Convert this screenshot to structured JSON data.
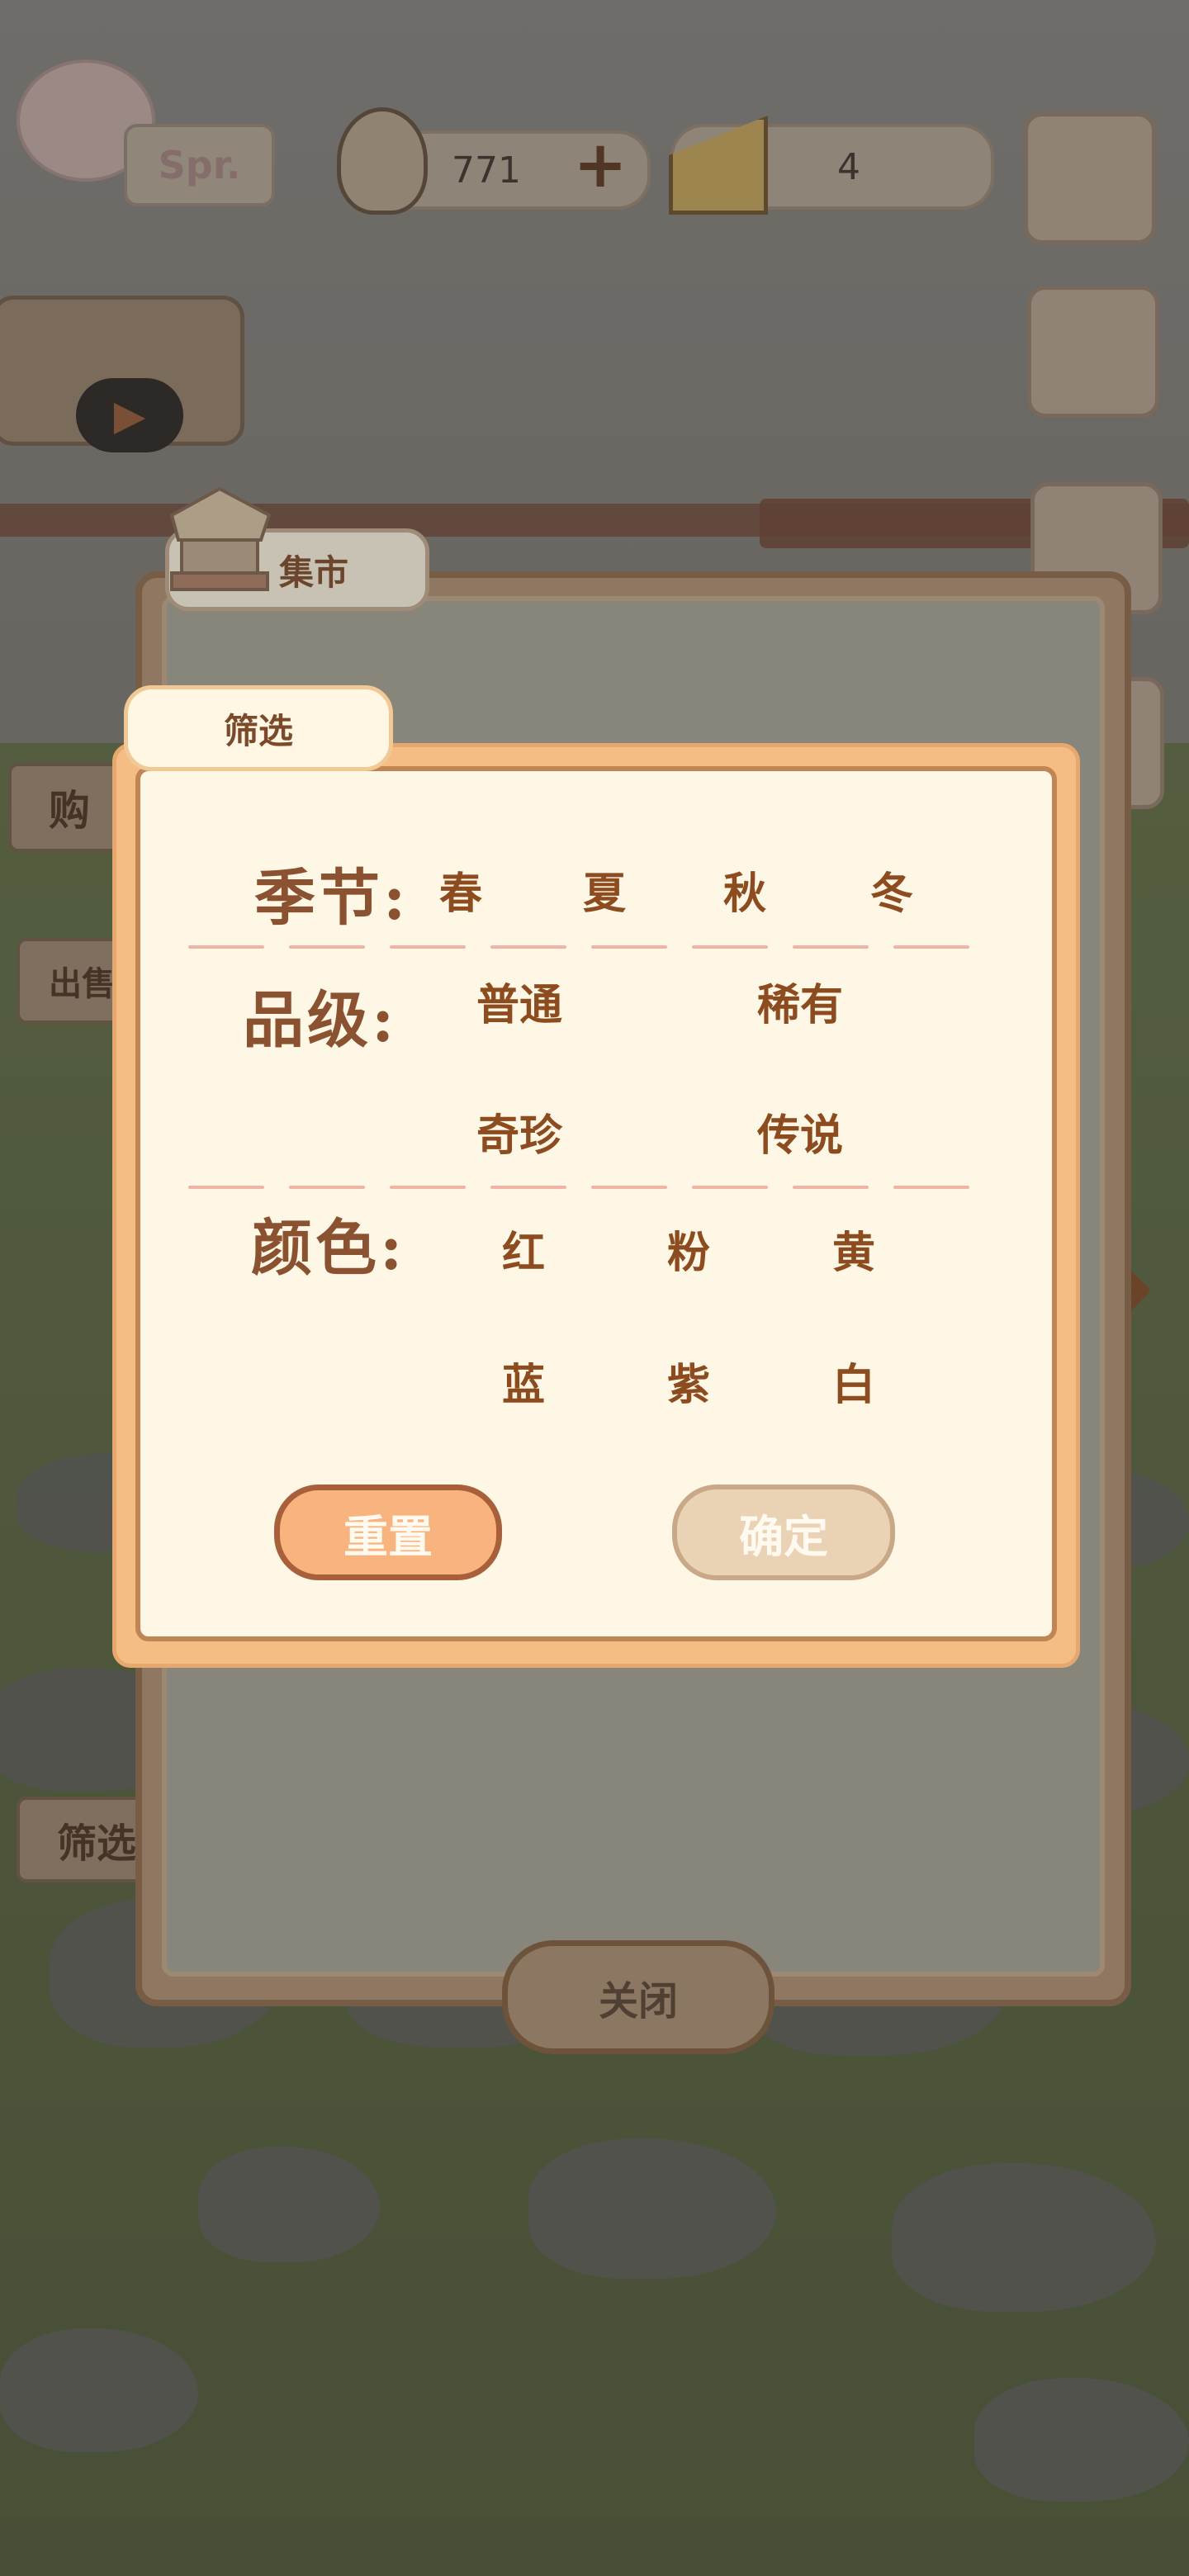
{
  "hud": {
    "logo_text": "Spr.",
    "fish_count": "771",
    "plus_symbol": "+",
    "cheese_count": "4"
  },
  "side": {
    "play_symbol": "▶",
    "buy_tab": "购",
    "sell_tab": "出售",
    "filter_tab": "筛选",
    "arrow_symbol": "➜"
  },
  "market": {
    "title": "集市",
    "close_label": "关闭"
  },
  "filter": {
    "title": "筛选",
    "season": {
      "label": "季节:",
      "options": [
        "春",
        "夏",
        "秋",
        "冬"
      ]
    },
    "grade": {
      "label": "品级:",
      "options": [
        "普通",
        "稀有",
        "奇珍",
        "传说"
      ]
    },
    "color": {
      "label": "颜色:",
      "options": [
        "红",
        "粉",
        "黄",
        "蓝",
        "紫",
        "白"
      ]
    },
    "reset_label": "重置",
    "confirm_label": "确定"
  }
}
